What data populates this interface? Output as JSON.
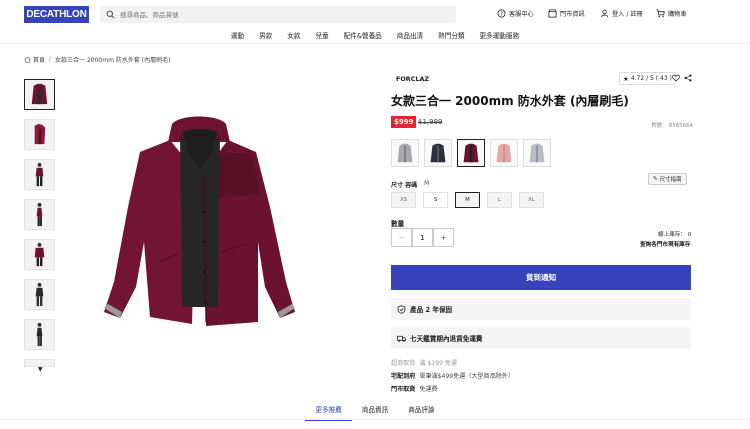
{
  "header": {
    "logo": "DECATHLON",
    "search_placeholder": "搜尋商品、商品貨號",
    "links": [
      {
        "label": "客服中心",
        "icon": "question-circle-icon"
      },
      {
        "label": "門市資訊",
        "icon": "store-icon"
      },
      {
        "label": "登入 / 註冊",
        "icon": "user-icon"
      },
      {
        "label": "購物車",
        "icon": "cart-icon"
      }
    ]
  },
  "nav": [
    "運動",
    "男款",
    "女款",
    "兒童",
    "配件&營養品",
    "商品出清",
    "熱門分類",
    "更多運動服務"
  ],
  "breadcrumb": [
    "首頁",
    "女款三合一 2000mm 防水外套 (內層刷毛)"
  ],
  "product": {
    "brand": "FORCLAZ",
    "rating": "4.72 / 5 ( 43 )",
    "title": "女款三合一 2000mm 防水外套 (內層刷毛)",
    "price": "$999",
    "old_price": "$1,999",
    "sku": "貨號： 8583664",
    "colors": [
      "light-grey",
      "dark-navy",
      "burgundy",
      "pink",
      "grey-blue"
    ],
    "selected_color": 2,
    "size_guide": "尺寸指南",
    "size_label": "尺寸 容碼",
    "size_selected": "M",
    "sizes": [
      "XS",
      "S",
      "M",
      "L",
      "XL"
    ],
    "available_sizes": [
      "S",
      "M"
    ],
    "qty_label": "數量",
    "qty": "1",
    "qty_minus": "−",
    "qty_plus": "+",
    "online_stock": "線上庫存： 0",
    "store_stock": "查詢各門市現有庫存",
    "notify_button": "貨到通知",
    "warranty": "產品 2 年保固",
    "return_policy": "七天鑑賞期內退貨免運費",
    "shipping": [
      {
        "k": "超商取貨",
        "v": "滿 $199 免運",
        "dim": true
      },
      {
        "k": "宅配到府",
        "v": "單筆滿$499免運（大型商品除外）",
        "dim": false
      },
      {
        "k": "門市取貨",
        "v": "免運費",
        "dim": false
      }
    ]
  },
  "tabs": [
    "更多推薦",
    "商品資訊",
    "商品評論"
  ],
  "active_tab": 0,
  "colors": {
    "brand": "#3643ba",
    "sale": "#e3262f",
    "burgundy": "#6d1230"
  }
}
